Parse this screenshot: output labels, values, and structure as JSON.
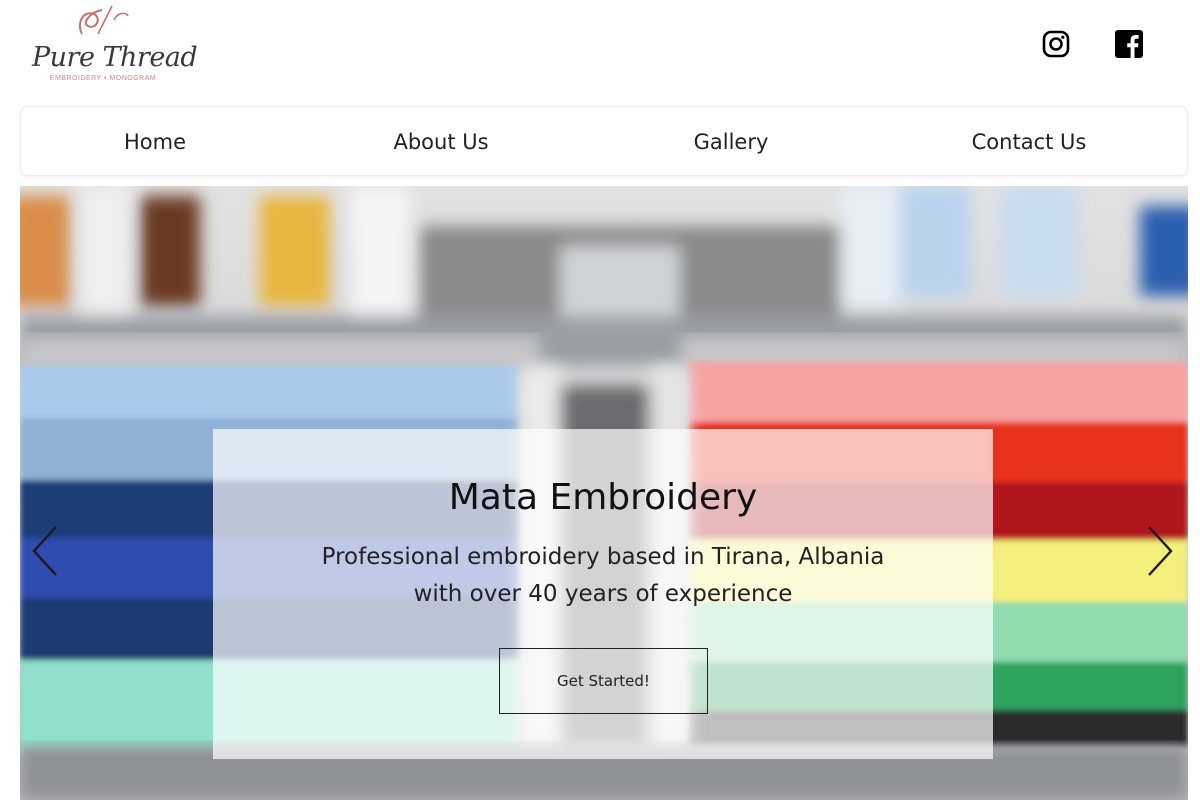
{
  "header": {
    "logo": {
      "name": "Pure Thread",
      "tagline": "EMBROIDERY • MONOGRAM",
      "accent_color": "#c96f6f"
    },
    "social": [
      {
        "icon": "instagram-icon"
      },
      {
        "icon": "facebook-icon"
      }
    ]
  },
  "nav": {
    "items": [
      {
        "label": "Home"
      },
      {
        "label": "About Us"
      },
      {
        "label": "Gallery"
      },
      {
        "label": "Contact Us"
      }
    ]
  },
  "hero": {
    "title": "Mata Embroidery",
    "subtitle_line1": "Professional embroidery based in Tirana, Albania",
    "subtitle_line2": "with over 40 years of experience",
    "cta_label": "Get Started!",
    "prev_icon": "chevron-left-icon",
    "next_icon": "chevron-right-icon"
  }
}
